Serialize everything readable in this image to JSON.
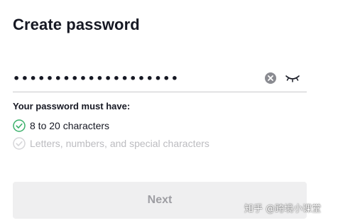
{
  "page": {
    "title": "Create password"
  },
  "password": {
    "masked_value": "••••••••••••••••••••",
    "clear_icon": "clear-circle-icon",
    "visibility_icon": "eye-closed-icon"
  },
  "requirements": {
    "heading": "Your password must have:",
    "items": [
      {
        "label": "8 to 20 characters",
        "met": true
      },
      {
        "label": "Letters, numbers, and special characters",
        "met": false
      }
    ]
  },
  "actions": {
    "next_label": "Next",
    "next_enabled": false
  },
  "watermark": {
    "text": "知乎 @跨境小课堂"
  },
  "colors": {
    "text_primary": "#161823",
    "check_met": "#3ab06a",
    "check_unmet": "#d6d6d9",
    "button_disabled_bg": "#efeff0",
    "button_disabled_text": "#9e9ea3"
  }
}
